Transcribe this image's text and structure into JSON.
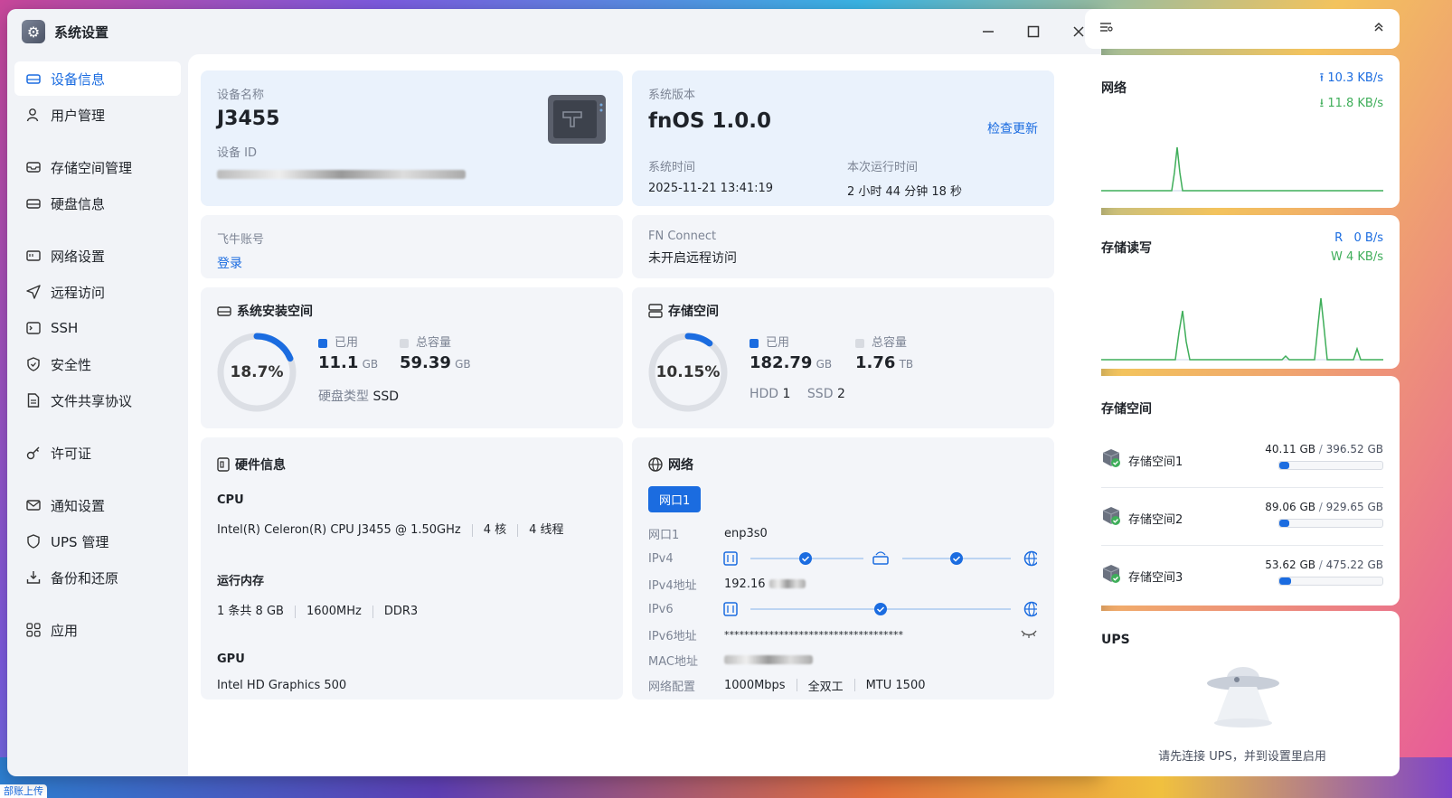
{
  "window": {
    "title": "系统设置"
  },
  "sidebar": {
    "items": [
      {
        "label": "设备信息"
      },
      {
        "label": "用户管理"
      },
      {
        "label": "存储空间管理"
      },
      {
        "label": "硬盘信息"
      },
      {
        "label": "网络设置"
      },
      {
        "label": "远程访问"
      },
      {
        "label": "SSH"
      },
      {
        "label": "安全性"
      },
      {
        "label": "文件共享协议"
      },
      {
        "label": "许可证"
      },
      {
        "label": "通知设置"
      },
      {
        "label": "UPS 管理"
      },
      {
        "label": "备份和还原"
      },
      {
        "label": "应用"
      }
    ]
  },
  "device": {
    "name_label": "设备名称",
    "name": "J3455",
    "id_label": "设备 ID"
  },
  "system": {
    "version_label": "系统版本",
    "version": "fnOS  1.0.0",
    "check_update": "检查更新",
    "time_label": "系统时间",
    "time": "2025-11-21 13:41:19",
    "uptime_label": "本次运行时间",
    "uptime": "2 小时 44 分钟 18 秒"
  },
  "account": {
    "label": "飞牛账号",
    "login": "登录"
  },
  "fnconnect": {
    "label": "FN Connect",
    "status": "未开启远程访问"
  },
  "sys_space": {
    "title": "系统安装空间",
    "percent": "18.7%",
    "percent_value": 18.7,
    "used_label": "已用",
    "used": "11.1",
    "used_unit": "GB",
    "total_label": "总容量",
    "total": "59.39",
    "total_unit": "GB",
    "disk_type_label": "硬盘类型",
    "disk_type": "SSD"
  },
  "storage": {
    "title": "存储空间",
    "percent": "10.15%",
    "percent_value": 10.15,
    "used_label": "已用",
    "used": "182.79",
    "used_unit": "GB",
    "total_label": "总容量",
    "total": "1.76",
    "total_unit": "TB",
    "hdd_label": "HDD",
    "hdd": "1",
    "ssd_label": "SSD",
    "ssd": "2"
  },
  "hardware": {
    "title": "硬件信息",
    "cpu_label": "CPU",
    "cpu": "Intel(R) Celeron(R) CPU J3455 @ 1.50GHz",
    "cores": "4 核",
    "threads": "4 线程",
    "mem_label": "运行内存",
    "mem": "1 条共 8 GB",
    "mem_speed": "1600MHz",
    "mem_type": "DDR3",
    "gpu_label": "GPU",
    "gpu": "Intel HD Graphics 500"
  },
  "network": {
    "title": "网络",
    "port_tab": "网口1",
    "port_label": "网口1",
    "port": "enp3s0",
    "ipv4_label": "IPv4",
    "ipv4_addr_label": "IPv4地址",
    "ipv4_addr": "192.16",
    "ipv6_label": "IPv6",
    "ipv6_addr_label": "IPv6地址",
    "ipv6_addr": "************************************",
    "mac_label": "MAC地址",
    "config_label": "网络配置",
    "speed": "1000Mbps",
    "duplex": "全双工",
    "mtu": "MTU 1500"
  },
  "right": {
    "net": {
      "title": "网络",
      "up": "10.3 KB/s",
      "down": "11.8 KB/s"
    },
    "io": {
      "title": "存储读写",
      "r_label": "R",
      "r": "0 B/s",
      "w_label": "W",
      "w": "4 KB/s"
    },
    "spaces": {
      "title": "存储空间",
      "items": [
        {
          "name": "存储空间1",
          "used": "40.11 GB",
          "total": "396.52 GB",
          "fraction": 0.1
        },
        {
          "name": "存储空间2",
          "used": "89.06 GB",
          "total": "929.65 GB",
          "fraction": 0.1
        },
        {
          "name": "存储空间3",
          "used": "53.62 GB",
          "total": "475.22 GB",
          "fraction": 0.11
        }
      ]
    },
    "ups": {
      "title": "UPS",
      "message": "请先连接 UPS，并到设置里启用"
    }
  },
  "desktop": {
    "upload_chip": "部账上传"
  },
  "colors": {
    "accent": "#1b6ce0",
    "green": "#3fae5a"
  }
}
